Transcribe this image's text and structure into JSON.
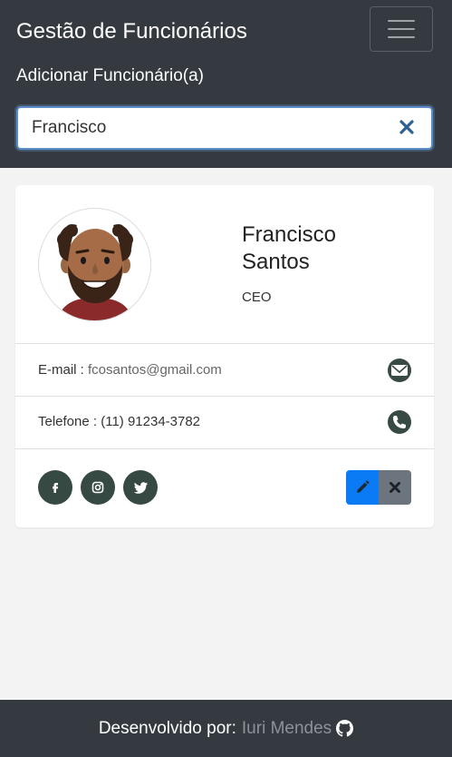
{
  "header": {
    "brand": "Gestão de Funcionários",
    "add_link": "Adicionar Funcionário(a)",
    "menu_icon": "hamburger-menu-icon"
  },
  "search": {
    "value": "Francisco",
    "clear_icon": "close-icon"
  },
  "employee": {
    "name": "Francisco Santos",
    "role": "CEO",
    "email_label": "E-mail :",
    "email": "fcosantos@gmail.com",
    "phone_label": "Telefone :",
    "phone": "(11) 91234-3782",
    "social": [
      "facebook-icon",
      "instagram-icon",
      "twitter-icon"
    ]
  },
  "footer": {
    "prefix": "Desenvolvido por:",
    "author": "Iuri Mendes",
    "icon": "github-icon"
  },
  "colors": {
    "navbar": "#343a40",
    "icon_dark_green": "#364a43",
    "edit_blue": "#0b7bf5",
    "delete_gray": "#6c757d"
  }
}
